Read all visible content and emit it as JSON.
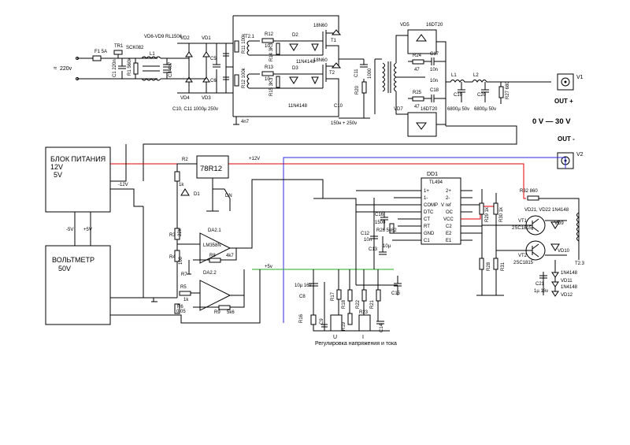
{
  "mains": {
    "voltage": "220v"
  },
  "fuse": {
    "label": "F1 5A"
  },
  "surge": {
    "ref": "TR1",
    "part": "SCK082"
  },
  "input_filter": {
    "c1": "C1 220n",
    "r1": "R1 560k",
    "l1": "L1",
    "c2": "C2 4n7",
    "c3": "C3 4n7"
  },
  "bridge": {
    "parts": "VD6-VD9 RL1506",
    "vd1": "VD1",
    "vd2": "VD2",
    "vd3": "VD3",
    "vd4": "VD4",
    "c5": "C5",
    "c6": "C6",
    "c4": "C4"
  },
  "bulk_caps": {
    "note": "C10, C11  1000µ 250v",
    "r11": "R11 100k",
    "r12": "R12 100k"
  },
  "driver": {
    "t2_1": "T2.1",
    "r12": "R12",
    "r13": "R13",
    "r10": "10",
    "r14": "R14 3K3",
    "r15": "R15 3K3",
    "d2": "D2",
    "d3": "D3",
    "t1": "T1",
    "t2": "T2",
    "mosfet": "18N60",
    "diode": "11N4148",
    "c12": "4n7"
  },
  "output_stage": {
    "vd5": "VD5",
    "vd7": "VD7",
    "diodes": "16DT20",
    "r24": "R24",
    "r25": "R25",
    "r47": "47",
    "c17": "C17",
    "c18": "C18",
    "c10n": "10n",
    "l1": "L1",
    "l2": "L2",
    "c19": "C19",
    "c20": "C20",
    "c19v": "6800µ 50v",
    "c20v": "6800µ 50v",
    "r27": "R27 680",
    "c11": "C11",
    "r20": "R20",
    "c10": "C10",
    "c10v": "150н + 250v",
    "r20v": "10k",
    "c11v": "1000"
  },
  "terminals": {
    "v1": "V1",
    "v2": "V2",
    "plus": "OUT +",
    "minus": "OUT -",
    "range": "0 V  —  30 V"
  },
  "psu": {
    "line1": "БЛОК ПИТАНИЯ",
    "line2": "12V",
    "line3": "5V",
    "minus12": "-12V",
    "minus5": "-5V",
    "plus5": "+5V"
  },
  "voltmeter": {
    "line1": "ВОЛЬТМЕТР",
    "line2": "50V"
  },
  "regulator": {
    "part": "78R12",
    "r2": "R2",
    "d1": "D1",
    "dn": "DN",
    "r2v": "1k"
  },
  "rails": {
    "plus12": "+12V",
    "plus5": "+5v"
  },
  "opamps": {
    "da21": "DA2.1",
    "da22": "DA2.2",
    "part": "LM358N",
    "r3": "R3",
    "r4": "R4",
    "r5": "R5",
    "r6": "R6",
    "r7": "R7",
    "r8": "R8",
    "r9": "R9",
    "r8v": "4k7",
    "r9v": "5k6",
    "r6v": "0.05",
    "r5v": "1k",
    "r3v": "22k",
    "r4v": "100"
  },
  "pwm": {
    "dd1": "DD1",
    "chip": "TL494",
    "pins_left": [
      "1+",
      "1-",
      "COMP",
      "DTC",
      "CT",
      "RT",
      "GND",
      "C1"
    ],
    "pins_right": [
      "2+",
      "2-",
      "V ref",
      "OC",
      "VCC",
      "C2",
      "E2",
      "E1"
    ],
    "c12": "C12",
    "c13": "C13",
    "c14": "C14",
    "c15": "C15",
    "c16": "C16",
    "r26": "R26 5k62",
    "c16v": "1500",
    "c12v": "10n",
    "c13v": "10µ"
  },
  "transistors": {
    "r32": "R32  860",
    "r29": "R29 1k",
    "r30": "R30 1k",
    "r28": "R28",
    "r31": "R31",
    "vt1": "VT1",
    "vt2": "VT2",
    "part": "2SC1815",
    "diodes": "VD21, VD22  1N4148",
    "vd9": "VD9",
    "vd10": "VD10",
    "t23": "T2.3",
    "c21": "C21",
    "c21v": "1µ 16v",
    "vd11": "VD11",
    "vd12": "VD12",
    "vd11v": "1N4148",
    "vd12v": "1N4148"
  },
  "pots": {
    "r16": "R16",
    "r17": "R17",
    "r18": "R18",
    "r19": "R19",
    "r21": "R21",
    "r22": "R22",
    "r23": "R23",
    "c8": "C8",
    "c8v": "10µ 16v",
    "c9": "C9",
    "c14": "C14",
    "u": "U",
    "i": "I"
  },
  "caption": "Регулировка напряжения и тока",
  "colors": {
    "wire": "#000000",
    "rail12": "#e00000",
    "rail_blue": "#2b2bd9",
    "rail5": "#22b022",
    "out_plus": "#e00000",
    "out_range": "#e040e0"
  }
}
